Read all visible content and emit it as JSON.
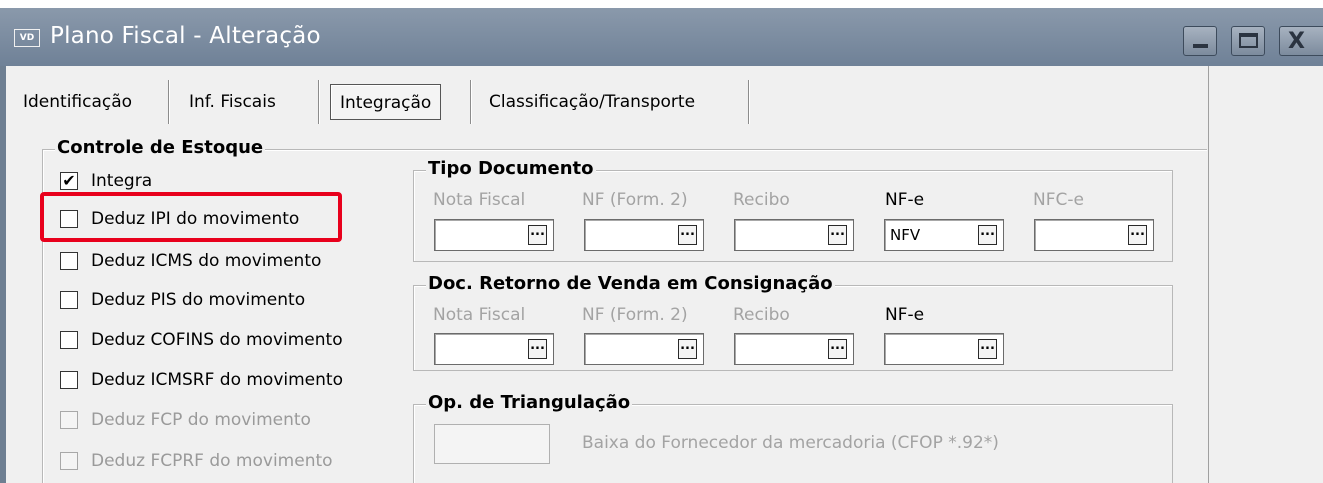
{
  "window": {
    "title": "Plano Fiscal - Alteração",
    "app_badge": "VD",
    "close_glyph": "X"
  },
  "tabs": [
    {
      "label": "Identificação",
      "active": false
    },
    {
      "label": "Inf. Fiscais",
      "active": false
    },
    {
      "label": "Integração",
      "active": true
    },
    {
      "label": "Classificação/Transporte",
      "active": false
    }
  ],
  "estoque": {
    "title": "Controle de Estoque",
    "items": [
      {
        "label": "Integra",
        "checked": true,
        "check_mark": "✔",
        "enabled": true
      },
      {
        "label": "Deduz IPI do movimento",
        "checked": false,
        "enabled": true,
        "highlighted": true
      },
      {
        "label": "Deduz ICMS do movimento",
        "checked": false,
        "enabled": true
      },
      {
        "label": "Deduz PIS do movimento",
        "checked": false,
        "enabled": true
      },
      {
        "label": "Deduz COFINS do movimento",
        "checked": false,
        "enabled": true
      },
      {
        "label": "Deduz ICMSRF do movimento",
        "checked": false,
        "enabled": true
      },
      {
        "label": "Deduz FCP do movimento",
        "checked": false,
        "enabled": false
      },
      {
        "label": "Deduz FCPRF do movimento",
        "checked": false,
        "enabled": false
      }
    ]
  },
  "tipo_documento": {
    "title": "Tipo Documento",
    "columns": [
      {
        "label": "Nota Fiscal",
        "value": "",
        "enabled": false
      },
      {
        "label": "NF (Form. 2)",
        "value": "",
        "enabled": false
      },
      {
        "label": "Recibo",
        "value": "",
        "enabled": false
      },
      {
        "label": "NF-e",
        "value": "NFV",
        "enabled": true
      },
      {
        "label": "NFC-e",
        "value": "",
        "enabled": false
      }
    ]
  },
  "retorno_consignacao": {
    "title": "Doc. Retorno de Venda em Consignação",
    "columns": [
      {
        "label": "Nota Fiscal",
        "value": "",
        "enabled": false
      },
      {
        "label": "NF (Form. 2)",
        "value": "",
        "enabled": false
      },
      {
        "label": "Recibo",
        "value": "",
        "enabled": false
      },
      {
        "label": "NF-e",
        "value": "",
        "enabled": true
      }
    ]
  },
  "triangulacao": {
    "title": "Op. de Triangulação",
    "value": "",
    "description": "Baixa do Fornecedor da mercadoria (CFOP *.92*)"
  },
  "lookup_button_glyph": "...",
  "colors": {
    "titlebar": "#7a8ba0",
    "highlight": "#e8001c",
    "disabled_text": "#a3a3a3"
  }
}
